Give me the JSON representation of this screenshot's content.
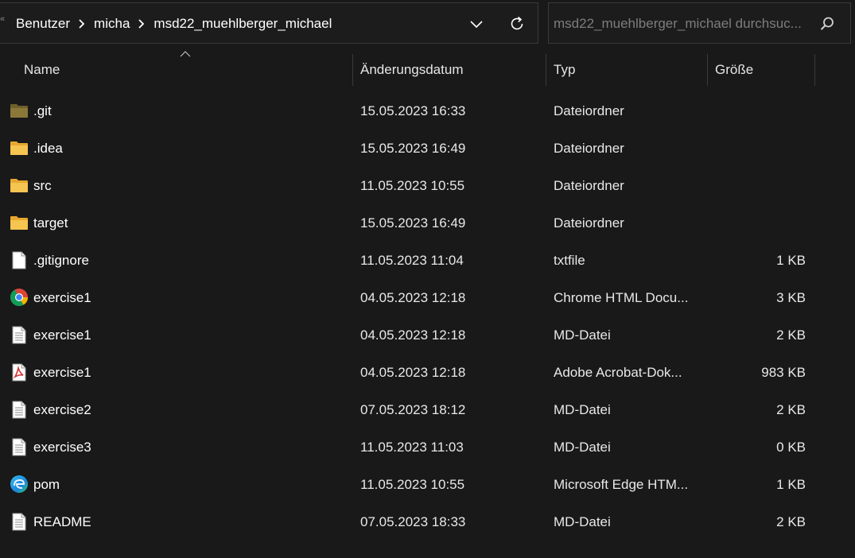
{
  "address_bar": {
    "crumbs": [
      "Benutzer",
      "micha",
      "msd22_muehlberger_michael"
    ]
  },
  "search": {
    "placeholder": "msd22_muehlberger_michael durchsuc..."
  },
  "columns": {
    "name": "Name",
    "date": "Änderungsdatum",
    "type": "Typ",
    "size": "Größe"
  },
  "files": [
    {
      "name": ".git",
      "date": "15.05.2023 16:33",
      "type": "Dateiordner",
      "size": "",
      "icon": "folder-dim-icon"
    },
    {
      "name": ".idea",
      "date": "15.05.2023 16:49",
      "type": "Dateiordner",
      "size": "",
      "icon": "folder-icon"
    },
    {
      "name": "src",
      "date": "11.05.2023 10:55",
      "type": "Dateiordner",
      "size": "",
      "icon": "folder-icon"
    },
    {
      "name": "target",
      "date": "15.05.2023 16:49",
      "type": "Dateiordner",
      "size": "",
      "icon": "folder-icon"
    },
    {
      "name": ".gitignore",
      "date": "11.05.2023 11:04",
      "type": "txtfile",
      "size": "1 KB",
      "icon": "blank-file-icon"
    },
    {
      "name": "exercise1",
      "date": "04.05.2023 12:18",
      "type": "Chrome HTML Docu...",
      "size": "3 KB",
      "icon": "chrome-icon"
    },
    {
      "name": "exercise1",
      "date": "04.05.2023 12:18",
      "type": "MD-Datei",
      "size": "2 KB",
      "icon": "text-file-icon"
    },
    {
      "name": "exercise1",
      "date": "04.05.2023 12:18",
      "type": "Adobe Acrobat-Dok...",
      "size": "983 KB",
      "icon": "pdf-icon"
    },
    {
      "name": "exercise2",
      "date": "07.05.2023 18:12",
      "type": "MD-Datei",
      "size": "2 KB",
      "icon": "text-file-icon"
    },
    {
      "name": "exercise3",
      "date": "11.05.2023 11:03",
      "type": "MD-Datei",
      "size": "0 KB",
      "icon": "text-file-icon"
    },
    {
      "name": "pom",
      "date": "11.05.2023 10:55",
      "type": "Microsoft Edge HTM...",
      "size": "1 KB",
      "icon": "edge-icon"
    },
    {
      "name": "README",
      "date": "07.05.2023 18:33",
      "type": "MD-Datei",
      "size": "2 KB",
      "icon": "text-file-icon"
    }
  ],
  "colors": {
    "background": "#191919",
    "folder": "#f5c04a",
    "folder_dim": "#8a7a3a",
    "pdf": "#d32f2f"
  }
}
